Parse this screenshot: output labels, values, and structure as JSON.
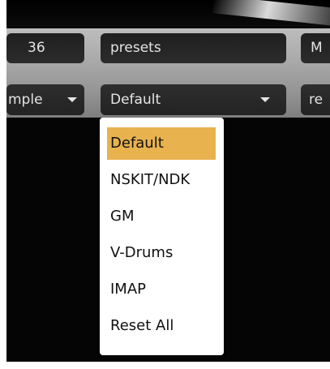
{
  "top_row": {
    "left_value": "36",
    "middle_value": "presets",
    "right_value": "M"
  },
  "dropdowns": {
    "left_label": "mple",
    "middle_label": "Default",
    "right_label": "re"
  },
  "menu": {
    "items": [
      "Default",
      "NSKIT/NDK",
      "GM",
      "V-Drums",
      "IMAP",
      "Reset All"
    ],
    "selected_index": 0
  },
  "colors": {
    "selected_highlight": "#e8b24e",
    "field_background": "#242424",
    "panel_background": "#a8a8a8"
  },
  "icons": {
    "dropdown_caret": "chevron-down-icon"
  }
}
